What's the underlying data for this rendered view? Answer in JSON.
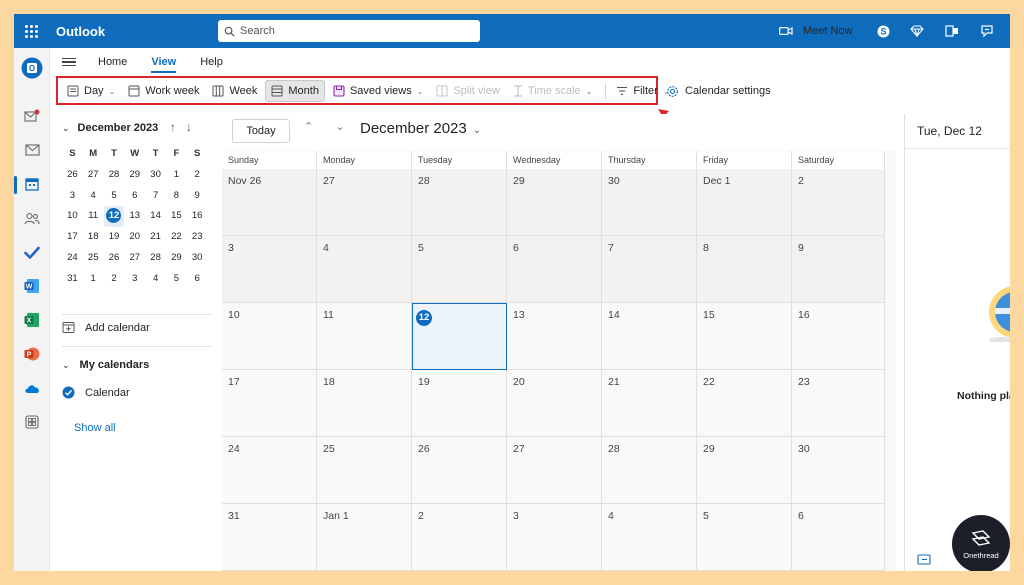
{
  "topbar": {
    "app_title": "Outlook",
    "search_placeholder": "Search",
    "meet_now": "Meet Now"
  },
  "menu_tabs": [
    "Home",
    "View",
    "Help"
  ],
  "active_tab": "View",
  "ribbon": {
    "day": "Day",
    "work_week": "Work week",
    "week": "Week",
    "month": "Month",
    "saved_views": "Saved views",
    "split_view": "Split view",
    "time_scale": "Time scale",
    "filter": "Filter",
    "calendar_settings": "Calendar settings"
  },
  "mini_calendar": {
    "title": "December 2023",
    "weekdays": [
      "S",
      "M",
      "T",
      "W",
      "T",
      "F",
      "S"
    ],
    "weeks": [
      [
        "26",
        "27",
        "28",
        "29",
        "30",
        "1",
        "2"
      ],
      [
        "3",
        "4",
        "5",
        "6",
        "7",
        "8",
        "9"
      ],
      [
        "10",
        "11",
        "12",
        "13",
        "14",
        "15",
        "16"
      ],
      [
        "17",
        "18",
        "19",
        "20",
        "21",
        "22",
        "23"
      ],
      [
        "24",
        "25",
        "26",
        "27",
        "28",
        "29",
        "30"
      ],
      [
        "31",
        "1",
        "2",
        "3",
        "4",
        "5",
        "6"
      ]
    ],
    "today": "12"
  },
  "left_panel": {
    "add_calendar": "Add calendar",
    "my_calendars": "My calendars",
    "calendar": "Calendar",
    "show_all": "Show all"
  },
  "calendar": {
    "today_button": "Today",
    "month_title": "December 2023",
    "day_headers": [
      "Sunday",
      "Monday",
      "Tuesday",
      "Wednesday",
      "Thursday",
      "Friday",
      "Saturday"
    ],
    "weeks": [
      [
        "Nov 26",
        "27",
        "28",
        "29",
        "30",
        "Dec 1",
        "2"
      ],
      [
        "3",
        "4",
        "5",
        "6",
        "7",
        "8",
        "9"
      ],
      [
        "10",
        "11",
        "12",
        "13",
        "14",
        "15",
        "16"
      ],
      [
        "17",
        "18",
        "19",
        "20",
        "21",
        "22",
        "23"
      ],
      [
        "24",
        "25",
        "26",
        "27",
        "28",
        "29",
        "30"
      ],
      [
        "31",
        "Jan 1",
        "2",
        "3",
        "4",
        "5",
        "6"
      ]
    ],
    "today": "12"
  },
  "right_panel": {
    "date": "Tue, Dec 12",
    "empty_message": "Nothing pla"
  },
  "brand": "Onethread",
  "colors": {
    "accent": "#0f6cbd",
    "highlight_box": "#d9252a",
    "frame_background": "#fcd7a0"
  }
}
